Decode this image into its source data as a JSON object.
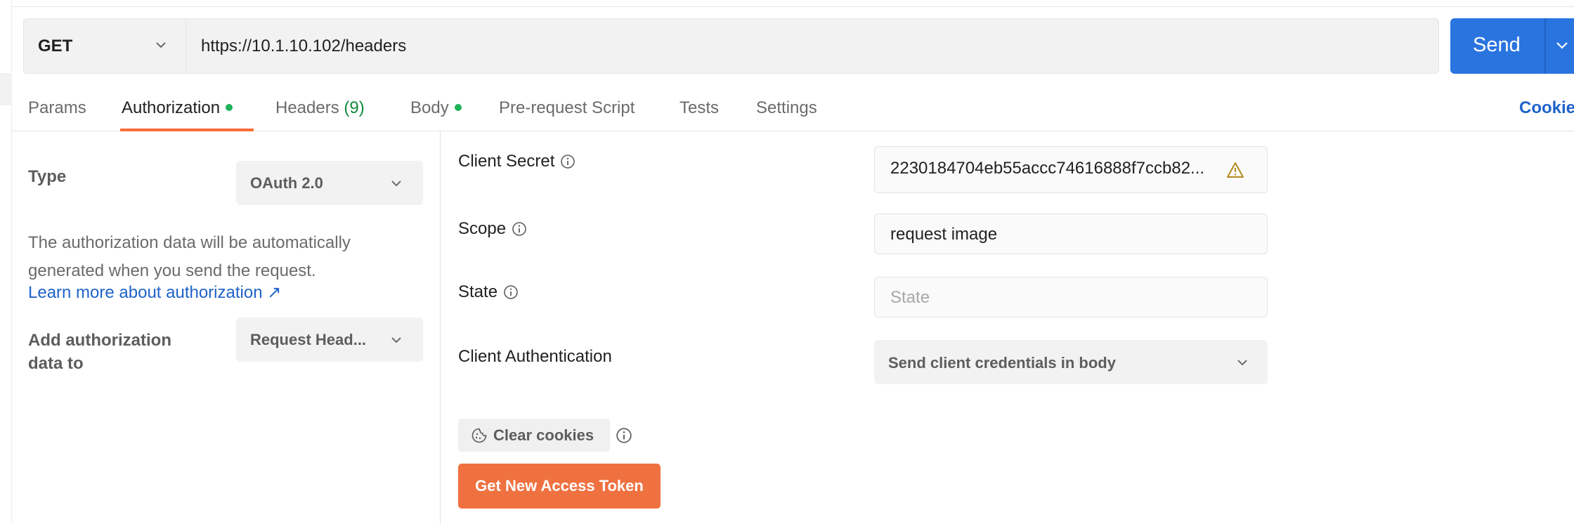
{
  "request": {
    "method": "GET",
    "url": "https://10.1.10.102/headers",
    "send_label": "Send"
  },
  "tabs": {
    "params": "Params",
    "authorization": "Authorization",
    "headers": "Headers",
    "headers_count": "(9)",
    "body": "Body",
    "pre_request": "Pre-request Script",
    "tests": "Tests",
    "settings": "Settings",
    "cookies": "Cookies"
  },
  "auth_left": {
    "type_label": "Type",
    "type_value": "OAuth 2.0",
    "description": "The authorization data will be automatically generated when you send the request.",
    "learn_more": "Learn more about authorization ↗",
    "add_to_label": "Add authorization data to",
    "add_to_value": "Request Head..."
  },
  "auth_right": {
    "client_secret_label": "Client Secret",
    "client_secret_value": "2230184704eb55accc74616888f7ccb82...",
    "scope_label": "Scope",
    "scope_value": "request image",
    "state_label": "State",
    "state_placeholder": "State",
    "client_auth_label": "Client Authentication",
    "client_auth_value": "Send client credentials in body",
    "clear_cookies": "Clear cookies",
    "get_token": "Get New Access Token"
  },
  "colors": {
    "accent_blue": "#2a74e0",
    "accent_orange": "#ef7140",
    "tab_indicator": "#ff6c37",
    "status_green": "#1fb25a",
    "link_blue": "#1f62c9"
  },
  "icons": {
    "info": "info-icon",
    "warning": "warning-icon",
    "chevron": "chevron-down-icon",
    "cookie": "cookie-icon"
  }
}
